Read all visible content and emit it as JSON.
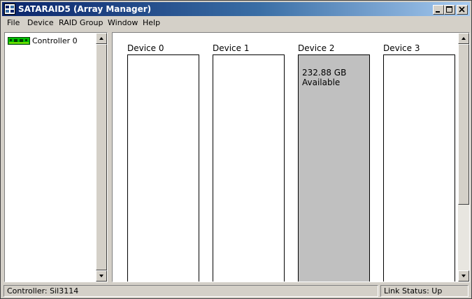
{
  "window": {
    "title": "SATARAID5 (Array Manager)",
    "icon": "sataraid-app-icon",
    "controls": [
      "minimize",
      "maximize",
      "close"
    ]
  },
  "menu": {
    "items": [
      {
        "label": "File"
      },
      {
        "label": "Device"
      },
      {
        "label": "RAID Group"
      },
      {
        "label": "Window"
      },
      {
        "label": "Help"
      }
    ]
  },
  "tree": {
    "items": [
      {
        "label": "Controller 0",
        "icon": "controller-card-icon"
      }
    ]
  },
  "devices": [
    {
      "label": "Device 0",
      "state": "empty",
      "text_line1": "",
      "text_line2": ""
    },
    {
      "label": "Device 1",
      "state": "empty",
      "text_line1": "",
      "text_line2": ""
    },
    {
      "label": "Device 2",
      "state": "available",
      "text_line1": "232.88 GB",
      "text_line2": "Available"
    },
    {
      "label": "Device 3",
      "state": "empty",
      "text_line1": "",
      "text_line2": ""
    }
  ],
  "status": {
    "controller": "Controller: Sil3114",
    "link": "Link Status: Up"
  },
  "colors": {
    "titlebar_start": "#0a246a",
    "titlebar_end": "#a6caf0",
    "face": "#d4d0c8",
    "available_fill": "#c0c0c0",
    "controller_icon": "#00c000"
  }
}
